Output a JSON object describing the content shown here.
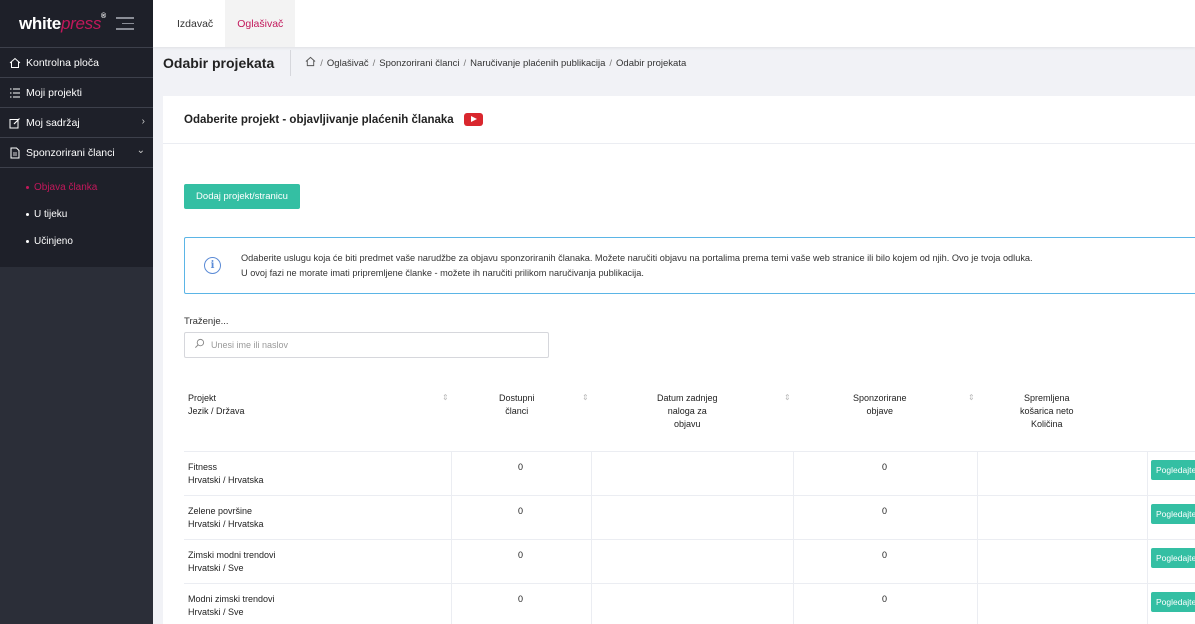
{
  "logo": {
    "white": "white",
    "press": "press",
    "reg": "®"
  },
  "sidebar": {
    "items": [
      {
        "label": "Kontrolna ploča"
      },
      {
        "label": "Moji projekti"
      },
      {
        "label": "Moj sadržaj"
      },
      {
        "label": "Sponzorirani članci"
      }
    ],
    "subitems": [
      {
        "label": "Objava članka"
      },
      {
        "label": "U tijeku"
      },
      {
        "label": "Učinjeno"
      }
    ]
  },
  "topbar": {
    "tabs": [
      {
        "label": "Izdavač"
      },
      {
        "label": "Oglašivač"
      }
    ]
  },
  "page": {
    "title": "Odabir projekata",
    "breadcrumb": [
      "Oglašivač",
      "Sponzorirani članci",
      "Naručivanje plaćenih publikacija",
      "Odabir projekata"
    ]
  },
  "card": {
    "title": "Odaberite projekt - objavljivanje plaćenih članaka",
    "add_button": "Dodaj projekt/stranicu",
    "alert": {
      "line1": "Odaberite uslugu koja će biti predmet vaše narudžbe za objavu sponzoriranih članaka. Možete naručiti objavu na portalima prema temi vaše web stranice ili bilo kojem od njih. Ovo je tvoja odluka.",
      "line2": "U ovoj fazi ne morate imati pripremljene članke - možete ih naručiti prilikom naručivanja publikacija."
    },
    "search": {
      "label": "Traženje...",
      "placeholder": "Unesi ime ili naslov"
    }
  },
  "table": {
    "headers": {
      "project": [
        "Projekt",
        "Jezik / Država"
      ],
      "available": [
        "Dostupni",
        "članci"
      ],
      "last_order": [
        "Datum zadnjeg",
        "naloga za",
        "objavu"
      ],
      "sponsored": [
        "Sponzorirane",
        "objave"
      ],
      "cart": [
        "Spremljena",
        "košarica neto",
        "Količina"
      ]
    },
    "view_label": "Pogledajte",
    "rows": [
      {
        "name": "Fitness",
        "lang": "Hrvatski / Hrvatska",
        "available": "0",
        "sponsored": "0"
      },
      {
        "name": "Zelene površine",
        "lang": "Hrvatski / Hrvatska",
        "available": "0",
        "sponsored": "0"
      },
      {
        "name": "Zimski modni trendovi",
        "lang": "Hrvatski / Sve",
        "available": "0",
        "sponsored": "0"
      },
      {
        "name": "Modni zimski trendovi",
        "lang": "Hrvatski / Sve",
        "available": "0",
        "sponsored": "0"
      }
    ]
  },
  "colors": {
    "accent": "#c2185b",
    "button": "#34bfa3",
    "sidebar": "#2b2e38",
    "info": "#5bb5e6"
  }
}
